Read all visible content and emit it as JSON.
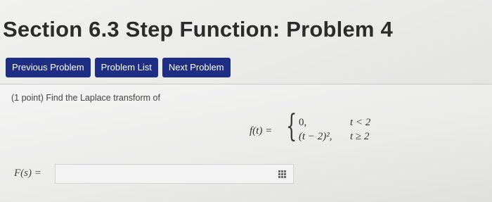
{
  "header": {
    "title": "Section 6.3 Step Function: Problem 4"
  },
  "nav": {
    "previous_label": "Previous Problem",
    "list_label": "Problem List",
    "next_label": "Next Problem"
  },
  "problem": {
    "points_text": "(1 point) Find the Laplace transform of",
    "formula": {
      "lhs": "f(t) =",
      "case1_value": "0,",
      "case1_condition": "t < 2",
      "case2_value": "(t − 2)², ",
      "case2_condition": "t ≥ 2"
    }
  },
  "answer": {
    "label": "F(s) =",
    "value": "",
    "icon": "equation-editor-grid-icon"
  },
  "colors": {
    "button_bg": "#1e2e82",
    "button_text": "#ffffff",
    "title_text": "#2b2b2b"
  }
}
